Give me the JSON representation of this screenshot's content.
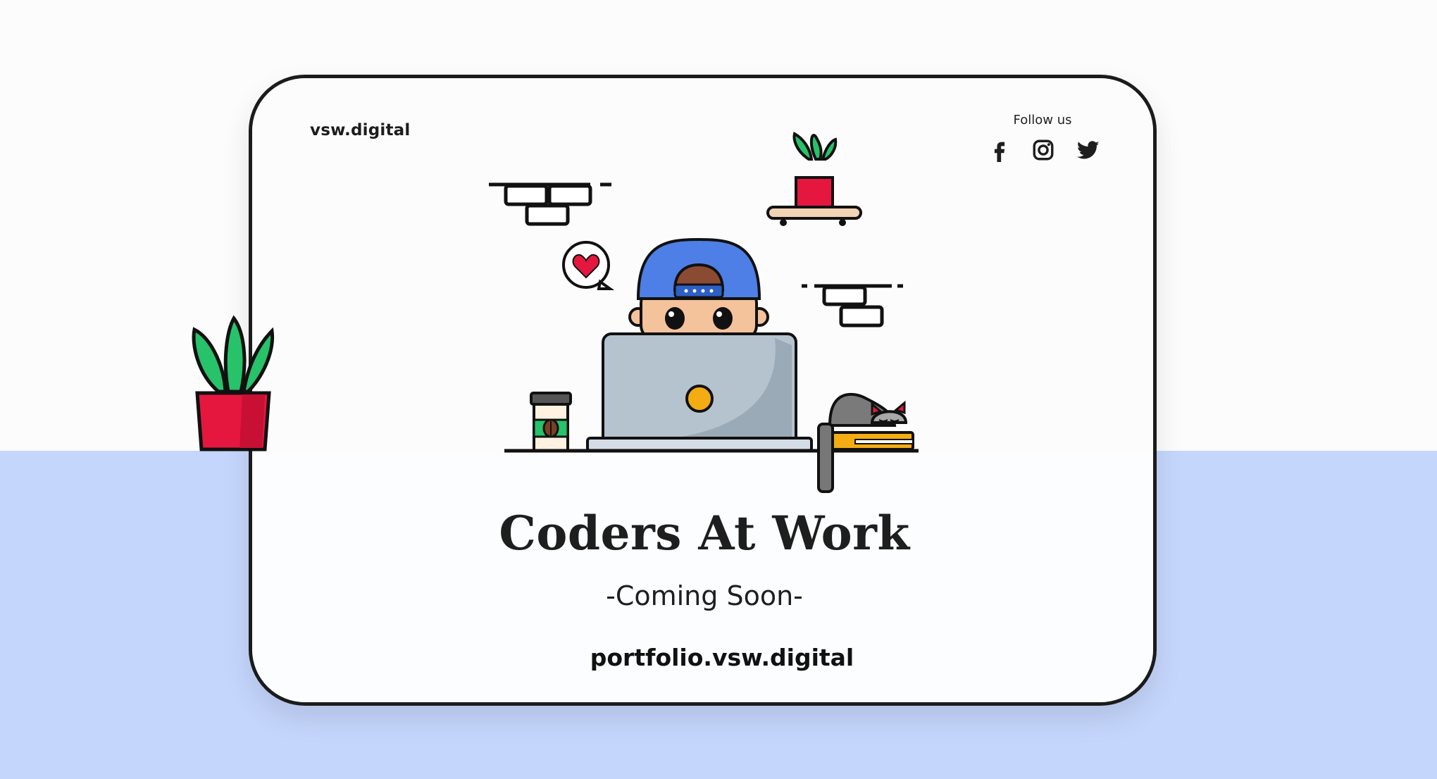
{
  "brand": "vsw.digital",
  "follow_label": "Follow us",
  "social": [
    {
      "name": "facebook",
      "icon": "facebook-icon"
    },
    {
      "name": "instagram",
      "icon": "instagram-icon"
    },
    {
      "name": "twitter",
      "icon": "twitter-icon"
    }
  ],
  "hero": {
    "title": "Coders At Work",
    "subtitle": "-Coming Soon-",
    "url": "portfolio.vsw.digital"
  },
  "colors": {
    "top_background": "#fcfcfc",
    "bottom_background": "#c5d6fc",
    "cap_blue": "#4d7fe6",
    "plant_green": "#27c26a",
    "pot_red": "#e5173f",
    "laptop_gray": "#b5c3cf",
    "accent_yellow": "#f4ac13"
  }
}
